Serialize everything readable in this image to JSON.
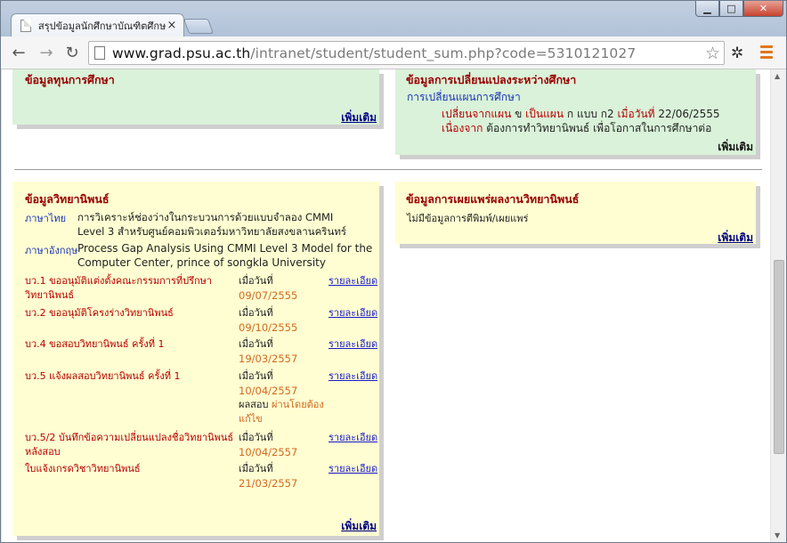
{
  "browser": {
    "tab_title": "สรุปข้อมูลนักศึกษาบัณฑิตศึกษ",
    "tab_close": "×",
    "url_host": "www.grad.psu.ac.th",
    "url_path": "/intranet/student/student_sum.php?code=5310121027",
    "window_min": "▁",
    "window_max": "□",
    "window_close": "✕"
  },
  "scholarship": {
    "title": "ข้อมูลทุนการศึกษา",
    "more": "เพิ่มเติม"
  },
  "plan_change": {
    "title": "ข้อมูลการเปลี่ยนแปลงระหว่างศึกษา",
    "heading": "การเปลี่ยนแผนการศึกษา",
    "line1_from_label": "เปลี่ยนจากแผน",
    "line1_from_value": "ข",
    "line1_to_label": "เป็นแผน",
    "line1_to_value": "ก แบบ ก2",
    "line1_date_label": "เมื่อวันที่",
    "line1_date_value": "22/06/2555",
    "line2_reason_label": "เนื่องจาก",
    "line2_reason_value": "ต้องการทำวิทยานิพนธ์ เพื่อโอกาสในการศึกษาต่อ",
    "more": "เพิ่มเติม"
  },
  "thesis": {
    "title": "ข้อมูลวิทยานิพนธ์",
    "thai_label": "ภาษาไทย",
    "thai_title": "การวิเคราะห์ช่องว่างในกระบวนการด้วยแบบจำลอง CMMI Level 3 สำหรับศูนย์คอมพิวเตอร์มหาวิทยาลัยสงขลานครินทร์",
    "english_label": "ภาษาอังกฤษ",
    "english_title": "Process Gap Analysis Using CMMI Level 3 Model for the Computer Center, prince of songkla University",
    "rows": [
      {
        "label": "บว.1 ขออนุมัติแต่งตั้งคณะกรรมการที่ปรึกษาวิทยานิพนธ์",
        "date_label": "เมื่อวันที่",
        "date": "09/07/2555",
        "link": "รายละเอียด"
      },
      {
        "label": "บว.2 ขออนุมัติโครงร่างวิทยานิพนธ์",
        "date_label": "เมื่อวันที่",
        "date": "09/10/2555",
        "link": "รายละเอียด"
      },
      {
        "label": "บว.4 ขอสอบวิทยานิพนธ์ ครั้งที่ 1",
        "date_label": "เมื่อวันที่",
        "date": "19/03/2557",
        "link": "รายละเอียด"
      },
      {
        "label": "บว.5 แจ้งผลสอบวิทยานิพนธ์ ครั้งที่ 1",
        "date_label": "เมื่อวันที่",
        "date": "10/04/2557",
        "link": "รายละเอียด",
        "result_label": "ผลสอบ",
        "result": "ผ่านโดยต้องแก้ไข"
      },
      {
        "label": "บว.5/2 บันทึกข้อความเปลี่ยนแปลงชื่อวิทยานิพนธ์หลังสอบ",
        "date_label": "เมื่อวันที่",
        "date": "10/04/2557",
        "link": "รายละเอียด"
      },
      {
        "label": "ใบแจ้งเกรดวิชาวิทยานิพนธ์",
        "date_label": "เมื่อวันที่",
        "date": "21/03/2557",
        "link": "รายละเอียด"
      }
    ],
    "more": "เพิ่มเติม"
  },
  "publication": {
    "title": "ข้อมูลการเผยแพร่ผลงานวิทยานิพนธ์",
    "empty": "ไม่มีข้อมูลการตีพิมพ์/เผยแพร่",
    "more": "เพิ่มเติม"
  },
  "colors": {
    "green_panel": "#d9f2d9",
    "yellow_panel": "#fefed2",
    "title_red": "#990000",
    "date_orange": "#d2691e",
    "link_blue": "#1a1acc"
  }
}
